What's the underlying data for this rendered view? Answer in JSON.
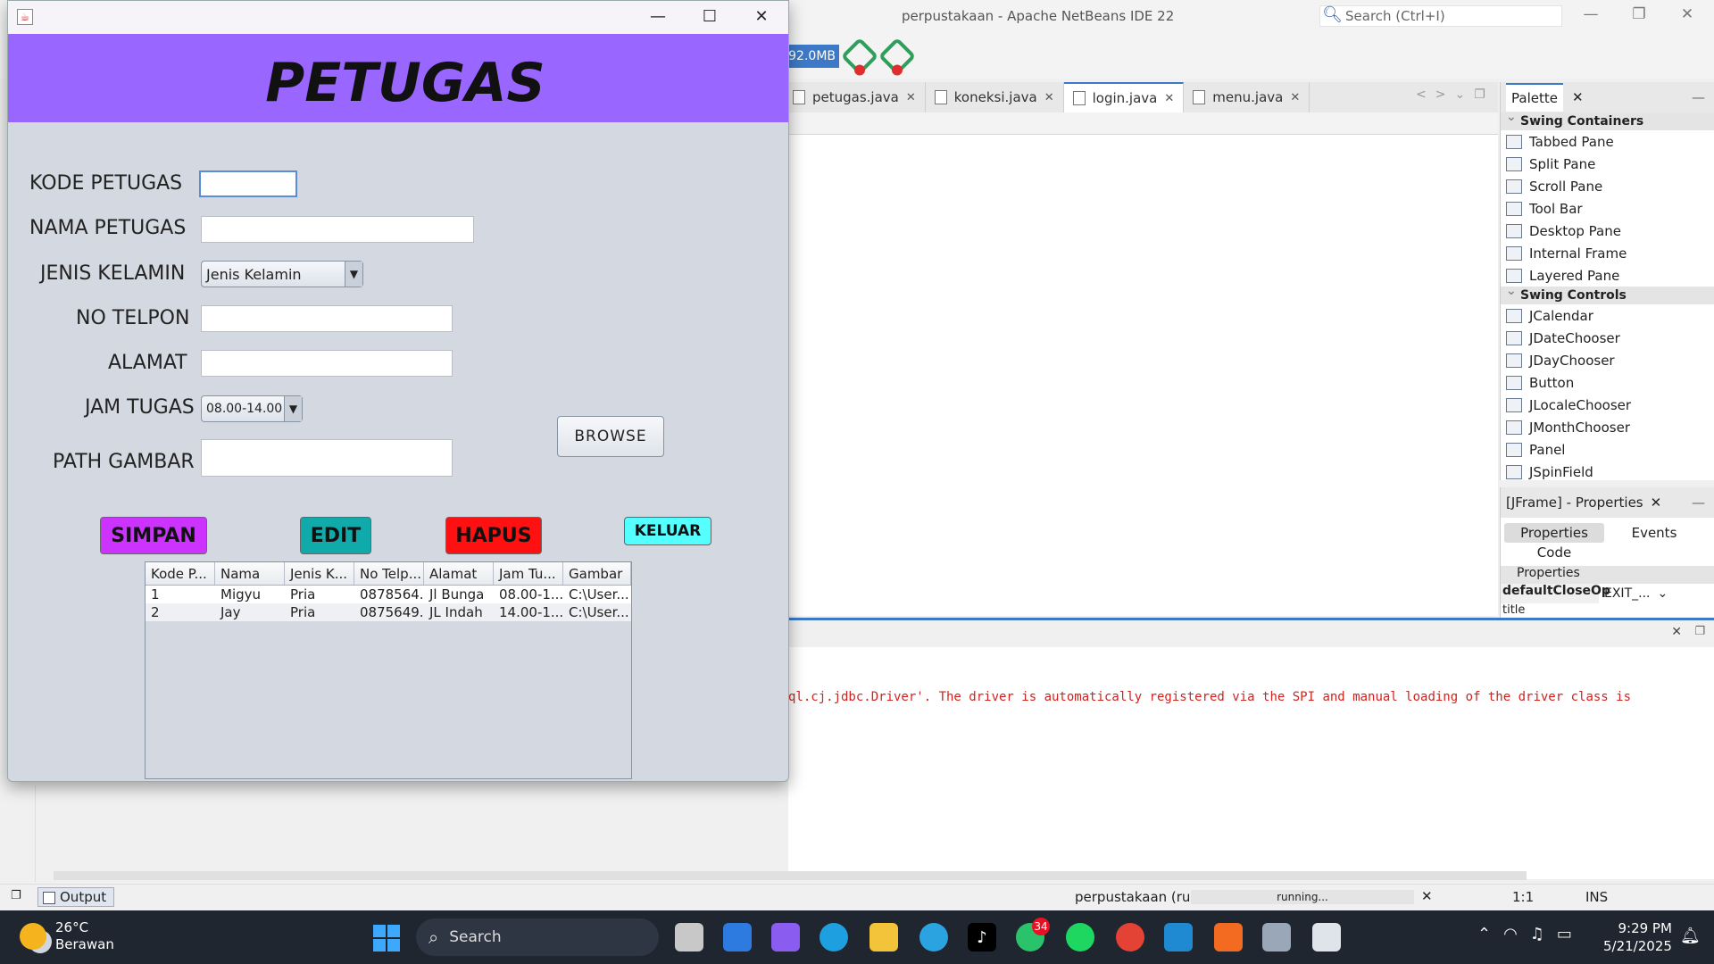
{
  "ide": {
    "title": "perpustakaan - Apache NetBeans IDE 22",
    "search_placeholder": "Search (Ctrl+I)",
    "memory": "92.0MB",
    "editor_tabs": [
      "petugas.java",
      "koneksi.java",
      "login.java",
      "menu.java"
    ],
    "active_tab": "login.java",
    "palette": {
      "title": "Palette",
      "categories": [
        {
          "name": "Swing Containers",
          "items": [
            "Tabbed Pane",
            "Split Pane",
            "Scroll Pane",
            "Tool Bar",
            "Desktop Pane",
            "Internal Frame",
            "Layered Pane"
          ]
        },
        {
          "name": "Swing Controls",
          "items": [
            "JCalendar",
            "JDateChooser",
            "JDayChooser",
            "Button",
            "JLocaleChooser",
            "JMonthChooser",
            "Panel",
            "JSpinField"
          ]
        }
      ]
    },
    "properties": {
      "title": "[JFrame] - Properties",
      "tab_properties": "Properties",
      "tab_events": "Events",
      "tab_code": "Code",
      "section": "Properties",
      "row_key": "defaultCloseOp",
      "row_value": "EXIT_...",
      "row2_key": "title"
    },
    "output_text": "ql.cj.jdbc.Driver'. The driver is automatically registered via the SPI and manual loading of the driver class is",
    "status": {
      "output_tab": "Output",
      "run_label": "perpustakaan (run)",
      "progress": "running...",
      "caret": "1:1",
      "mode": "INS"
    }
  },
  "app": {
    "heading": "PETUGAS",
    "labels": {
      "kode": "KODE PETUGAS",
      "nama": "NAMA PETUGAS",
      "jenis": "JENIS KELAMIN",
      "telpon": "NO TELPON",
      "alamat": "ALAMAT",
      "jam": "JAM TUGAS",
      "path": "PATH GAMBAR"
    },
    "values": {
      "kode": "",
      "nama": "",
      "telpon": "",
      "alamat": "",
      "path": ""
    },
    "combo_jenis": "Jenis Kelamin",
    "combo_jam": "08.00-14.00",
    "buttons": {
      "browse": "BROWSE",
      "simpan": "SIMPAN",
      "edit": "EDIT",
      "hapus": "HAPUS",
      "keluar": "KELUAR"
    },
    "table": {
      "columns": [
        "Kode P...",
        "Nama",
        "Jenis K...",
        "No Telp...",
        "Alamat",
        "Jam Tu...",
        "Gambar"
      ],
      "rows": [
        [
          "1",
          "Migyu",
          "Pria",
          "0878564...",
          "Jl Bunga",
          "08.00-1...",
          "C:\\User..."
        ],
        [
          "2",
          "Jay",
          "Pria",
          "0875649...",
          "JL Indah",
          "14.00-1...",
          "C:\\User..."
        ]
      ]
    }
  },
  "taskbar": {
    "weather_temp": "26°C",
    "weather_desc": "Berawan",
    "search": "Search",
    "whatsapp_badge": "34",
    "time": "9:29 PM",
    "date": "5/21/2025"
  }
}
